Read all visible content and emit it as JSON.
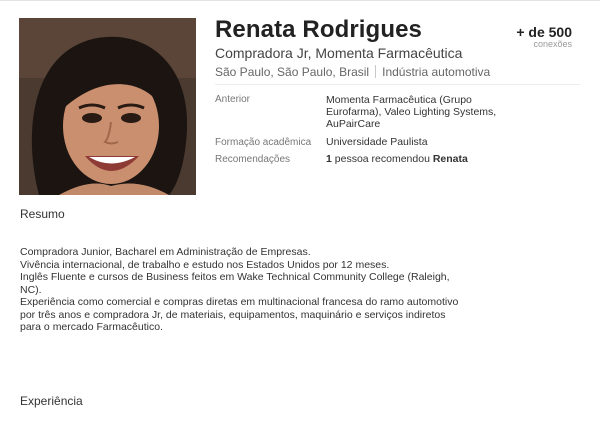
{
  "profile": {
    "name": "Renata Rodrigues",
    "headline": "Compradora Jr, Momenta Farmacêutica",
    "location": "São Paulo, São Paulo, Brasil",
    "industry": "Indústria automotiva",
    "connections_count": "+ de 500",
    "connections_label": "conexões"
  },
  "details": {
    "previous_label": "Anterior",
    "previous_line1": "Momenta Farmacêutica (Grupo",
    "previous_line2": "Eurofarma), Valeo Lighting Systems,",
    "previous_line3": "AuPairCare",
    "education_label": "Formação acadêmica",
    "education_value": "Universidade Paulista",
    "recommendations_label": "Recomendações",
    "recommendations_count": "1",
    "recommendations_text": " pessoa recomendou ",
    "recommendations_name": "Renata"
  },
  "summary": {
    "title": "Resumo",
    "lines": [
      "Compradora Junior, Bacharel em Administração de Empresas.",
      "Vivência internacional, de trabalho e estudo nos Estados Unidos por 12 meses.",
      "Inglês Fluente e cursos de Business feitos em Wake Technical Community College (Raleigh,",
      "NC).",
      "Experiência como comercial e compras diretas em multinacional francesa do ramo automotivo",
      "por três anos e compradora Jr, de materiais, equipamentos, maquinário e serviços indiretos",
      "para o mercado Farmacêutico."
    ]
  },
  "experience": {
    "title": "Experiência"
  }
}
